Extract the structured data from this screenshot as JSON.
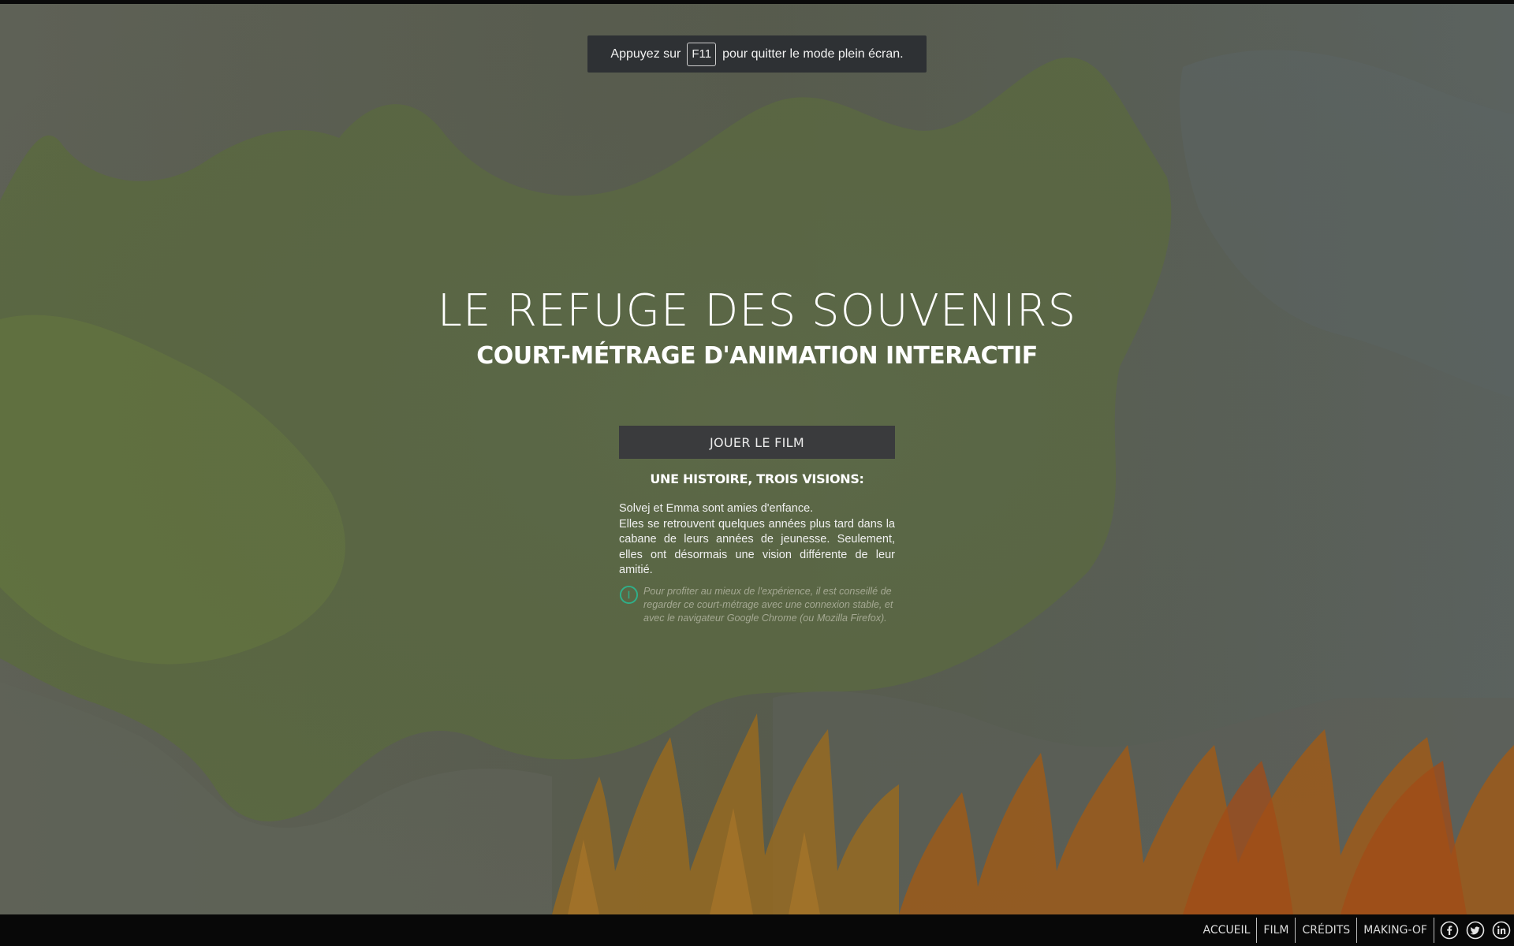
{
  "fullscreen_notice": {
    "before": "Appuyez sur",
    "key": "F11",
    "after": "pour quitter le mode plein écran."
  },
  "hero": {
    "title": "LE REFUGE DES SOUVENIRS",
    "subtitle": "COURT-MÉTRAGE D'ANIMATION INTERACTIF"
  },
  "play_button": "JOUER LE FILM",
  "section_title": "UNE HISTOIRE, TROIS VISIONS:",
  "synopsis": {
    "line1": "Solvej et Emma sont amies d'enfance.",
    "line2": "Elles se retrouvent quelques années plus tard dans la cabane de leurs années de jeunesse. Seulement, elles ont désormais une vision différente de leur amitié."
  },
  "advice": "Pour profiter au mieux de l'expérience, il est conseillé de regarder ce court-métrage avec une connexion stable, et avec le navigateur Google Chrome (ou Mozilla Firefox).",
  "nav": {
    "home": "ACCUEIL",
    "film": "FILM",
    "credits": "CRÉDITS",
    "making_of": "MAKING-OF"
  },
  "social": [
    "facebook-icon",
    "twitter-icon",
    "linkedin-icon"
  ],
  "colors": {
    "info_accent": "#2fb08a",
    "button_bg": "#3a3b3d",
    "footer_bg": "#080808"
  }
}
